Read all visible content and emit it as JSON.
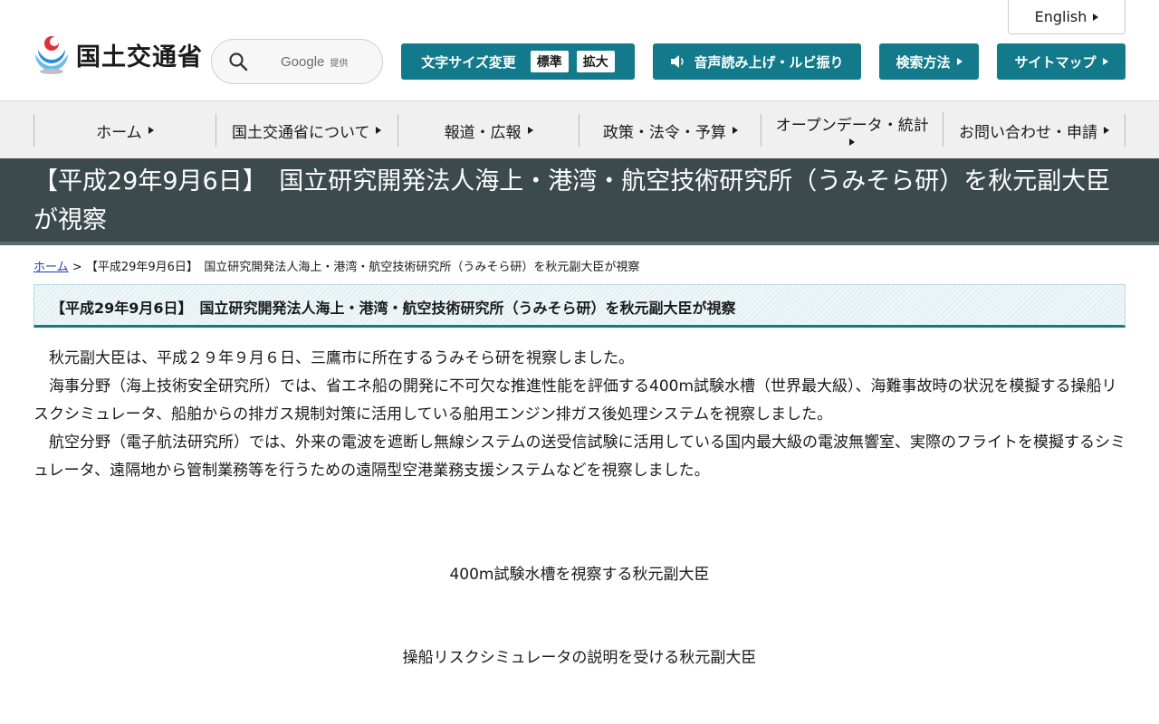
{
  "header": {
    "lang_label": "English",
    "logo_text": "国土交通省",
    "search": {
      "google_label": "Google",
      "provided_label": "提供"
    },
    "font_size": {
      "label": "文字サイズ変更",
      "standard": "標準",
      "large": "拡大"
    },
    "voice_label": "音声読み上げ・ルビ振り",
    "search_method_label": "検索方法",
    "sitemap_label": "サイトマップ"
  },
  "nav": {
    "items": [
      {
        "label": "ホーム"
      },
      {
        "label": "国土交通省について"
      },
      {
        "label": "報道・広報"
      },
      {
        "label": "政策・法令・予算"
      },
      {
        "label": "オープンデータ・統計"
      },
      {
        "label": "お問い合わせ・申請"
      }
    ]
  },
  "page": {
    "title": "【平成29年9月6日】　国立研究開発法人海上・港湾・航空技術研究所（うみそら研）を秋元副大臣が視察",
    "breadcrumb_home": "ホーム",
    "breadcrumb_sep": ">",
    "breadcrumb_current": "【平成29年9月6日】　国立研究開発法人海上・港湾・航空技術研究所（うみそら研）を秋元副大臣が視察",
    "heading": "【平成29年9月6日】　国立研究開発法人海上・港湾・航空技術研究所（うみそら研）を秋元副大臣が視察",
    "paragraphs": [
      "秋元副大臣は、平成２９年９月６日、三鷹市に所在するうみそら研を視察しました。",
      "海事分野（海上技術安全研究所）では、省エネ船の開発に不可欠な推進性能を評価する400m試験水槽（世界最大級）、海難事故時の状況を模擬する操船リスクシミュレータ、船舶からの排ガス規制対策に活用している舶用エンジン排ガス後処理システムを視察しました。",
      "航空分野（電子航法研究所）では、外来の電波を遮断し無線システムの送受信試験に活用している国内最大級の電波無響室、実際のフライトを模擬するシミュレータ、遠隔地から管制業務等を行うための遠隔型空港業務支援システムなどを視察しました。"
    ],
    "captions": [
      "400m試験水槽を視察する秋元副大臣",
      "操船リスクシミュレータの説明を受ける秋元副大臣"
    ]
  },
  "colors": {
    "teal": "#127a8a",
    "title_band": "#3c4a4e",
    "nav_bg": "#f0f0f0",
    "link": "#1a3fa8"
  }
}
